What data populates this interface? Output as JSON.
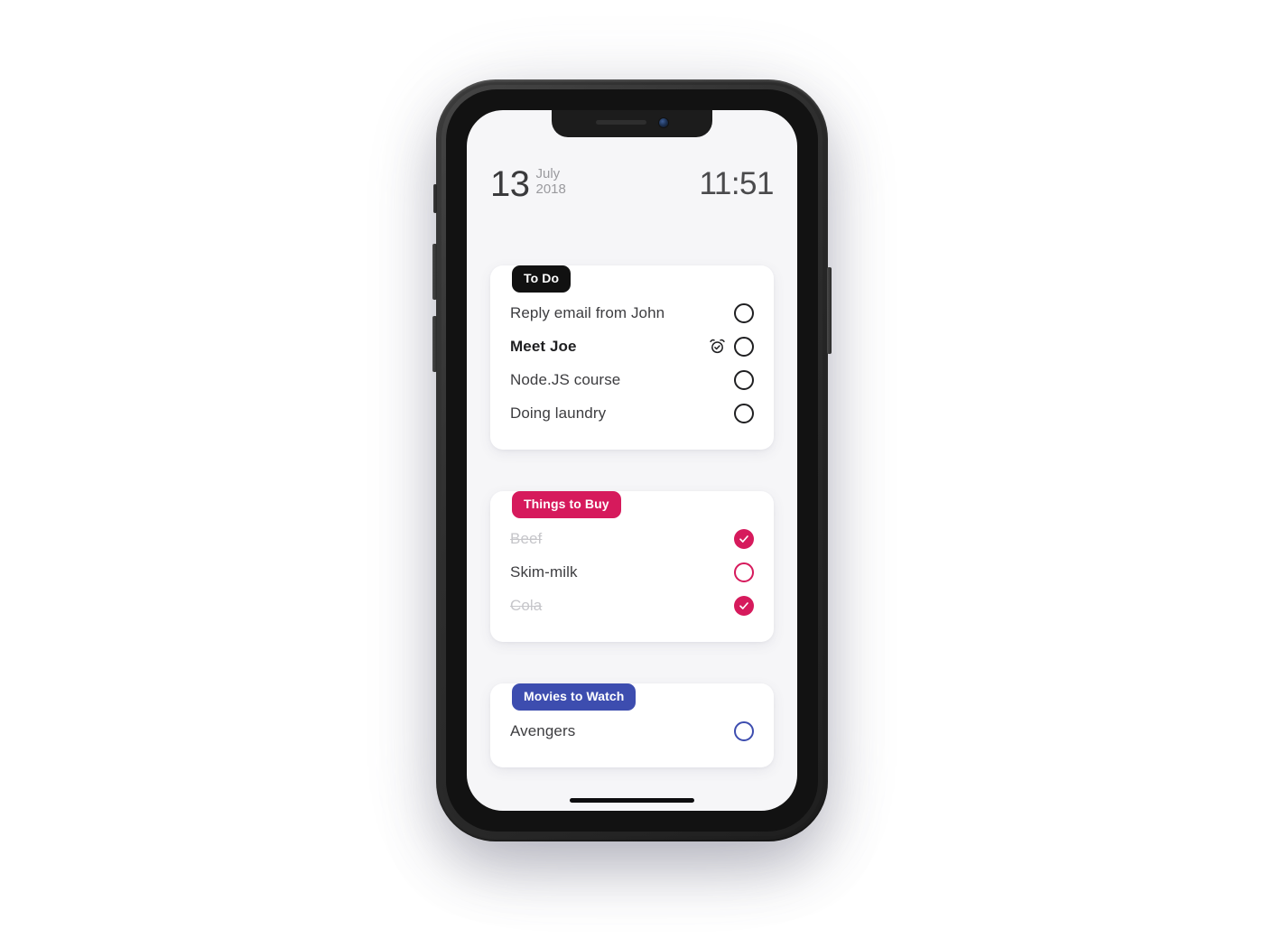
{
  "device": {
    "name": "smartphone-mockup",
    "notch": {
      "speaker": "earpiece-speaker",
      "camera": "front-camera"
    },
    "buttons": [
      "silent-switch",
      "volume-up",
      "volume-down",
      "power"
    ]
  },
  "status_bar": {
    "date": {
      "day": "13",
      "month": "July",
      "year": "2018"
    },
    "time": "11:51"
  },
  "colors": {
    "todo_badge": "#111111",
    "buy_badge": "#d61a5c",
    "movies_badge": "#3d4daf",
    "screen_bg": "#f6f6f8",
    "card_bg": "#ffffff",
    "text_primary": "#3d3d40",
    "text_done": "#c6c6ca"
  },
  "lists": [
    {
      "id": "todo",
      "badge": "To Do",
      "badge_color": "#111111",
      "checkbox_style": "dark",
      "items": [
        {
          "label": "Reply email from John",
          "done": false,
          "bold": false,
          "alarm": false
        },
        {
          "label": "Meet Joe",
          "done": false,
          "bold": true,
          "alarm": true
        },
        {
          "label": "Node.JS course",
          "done": false,
          "bold": false,
          "alarm": false
        },
        {
          "label": "Doing laundry",
          "done": false,
          "bold": false,
          "alarm": false
        }
      ]
    },
    {
      "id": "things-to-buy",
      "badge": "Things to Buy",
      "badge_color": "#d61a5c",
      "checkbox_style": "pink",
      "items": [
        {
          "label": "Beef",
          "done": true,
          "bold": false,
          "alarm": false
        },
        {
          "label": "Skim-milk",
          "done": false,
          "bold": false,
          "alarm": false
        },
        {
          "label": "Cola",
          "done": true,
          "bold": false,
          "alarm": false
        }
      ]
    },
    {
      "id": "movies-to-watch",
      "badge": "Movies to Watch",
      "badge_color": "#3d4daf",
      "checkbox_style": "blue",
      "items": [
        {
          "label": "Avengers",
          "done": false,
          "bold": false,
          "alarm": false
        }
      ]
    }
  ],
  "icons": {
    "alarm": "alarm-clock-icon",
    "check": "check-icon",
    "home_indicator": "home-indicator"
  }
}
